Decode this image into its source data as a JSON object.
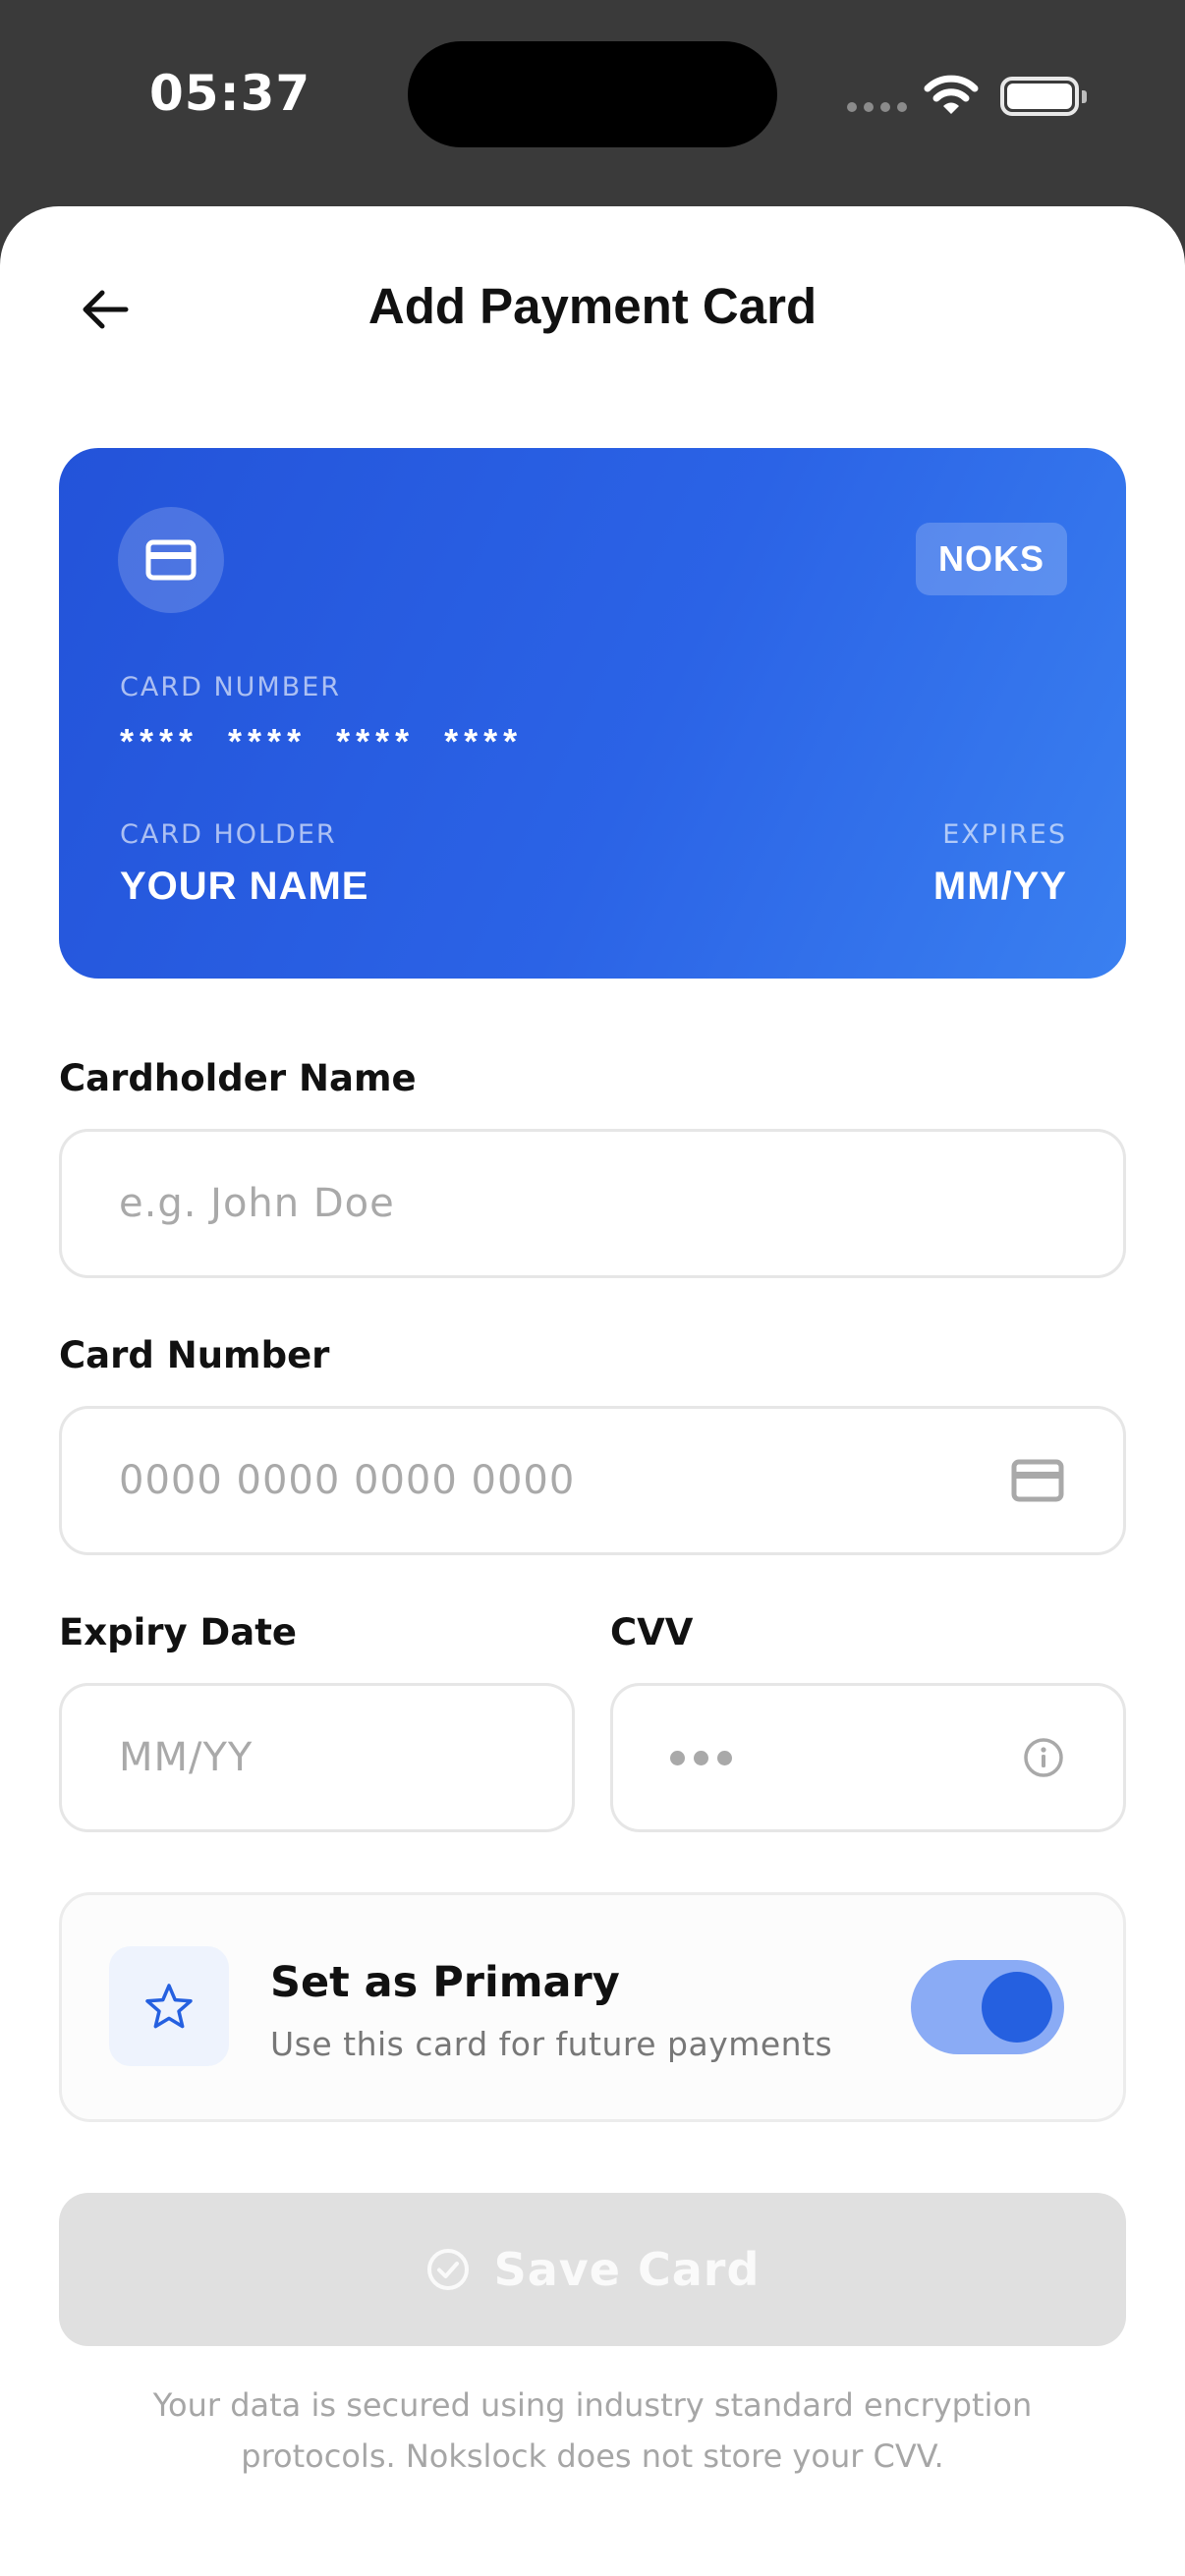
{
  "status_bar": {
    "time": "05:37",
    "icons": [
      "signal-dots-icon",
      "wifi-icon",
      "battery-icon"
    ]
  },
  "header": {
    "title": "Add Payment Card",
    "back_icon": "arrow-left-icon"
  },
  "card_preview": {
    "brand": "NOKS",
    "number_label": "CARD NUMBER",
    "number": "**** **** **** ****",
    "holder_label": "CARD HOLDER",
    "holder": "YOUR NAME",
    "expires_label": "EXPIRES",
    "expires": "MM/YY",
    "colors": {
      "gradient_start": "#2353d9",
      "gradient_end": "#3a80f0"
    }
  },
  "form": {
    "cardholder": {
      "label": "Cardholder Name",
      "placeholder": "e.g. John Doe",
      "value": ""
    },
    "card_number": {
      "label": "Card Number",
      "placeholder": "0000 0000 0000 0000",
      "value": "",
      "icon": "credit-card-icon"
    },
    "expiry": {
      "label": "Expiry Date",
      "placeholder": "MM/YY",
      "value": ""
    },
    "cvv": {
      "label": "CVV",
      "value": "",
      "icon": "info-icon"
    }
  },
  "primary": {
    "title": "Set as Primary",
    "subtitle": "Use this card for future payments",
    "enabled": true,
    "icon": "star-icon"
  },
  "save_button": {
    "label": "Save Card",
    "enabled": false,
    "icon": "check-circle-icon"
  },
  "footer_note": "Your data is secured using industry standard encryption protocols. Nokslock does not store your CVV.",
  "colors": {
    "accent": "#2560e0",
    "toggle_track": "#8aabf5",
    "disabled_button": "#e0e0e0"
  }
}
